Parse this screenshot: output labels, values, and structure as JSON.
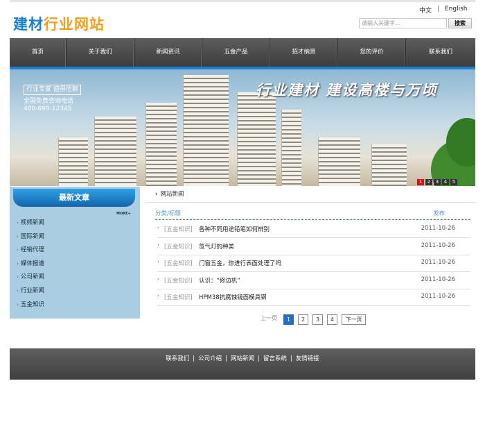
{
  "header": {
    "logo_part1": "建材",
    "logo_part2": "行业网站",
    "lang_cn": "中文",
    "lang_sep": "|",
    "lang_en": "English",
    "search_placeholder": "请输入关键字...",
    "search_button": "搜索"
  },
  "nav": [
    {
      "label": "首页"
    },
    {
      "label": "关于我们"
    },
    {
      "label": "新闻资讯"
    },
    {
      "label": "五金产品"
    },
    {
      "label": "招才纳贤"
    },
    {
      "label": "您的评价"
    },
    {
      "label": "联系我们"
    }
  ],
  "banner": {
    "tag": "行业专家 值得信赖",
    "hotline_label": "全国免费咨询电话",
    "hotline": "400-699-12345",
    "slogan": "行业建材  建设高楼与万顷",
    "pages": [
      "1",
      "2",
      "3",
      "4",
      "5"
    ]
  },
  "sidebar": {
    "title": "最新文章",
    "more": "MORE+",
    "items": [
      "视频新闻",
      "国际新闻",
      "经销代理",
      "媒体报道",
      "公司新闻",
      "行业新闻",
      "五金知识"
    ]
  },
  "content": {
    "tab_arrow": "›",
    "tab": "网站新闻",
    "col_title": "分类/标题",
    "col_date": "发布",
    "rows": [
      {
        "cat": "[五金知识]",
        "title": "各种不同用途铅笔如何辨别",
        "date": "2011-10-26"
      },
      {
        "cat": "[五金知识]",
        "title": "氙气灯的种类",
        "date": "2011-10-26"
      },
      {
        "cat": "[五金知识]",
        "title": "门窗五金，你进行表面处理了吗",
        "date": "2011-10-26"
      },
      {
        "cat": "[五金知识]",
        "title": "认识：“修边机”",
        "date": "2011-10-26"
      },
      {
        "cat": "[五金知识]",
        "title": "HPM38抗腐蚀镜面模具钢",
        "date": "2011-10-26"
      }
    ],
    "pagination": {
      "prev": "上一页",
      "pages": [
        "1",
        "2",
        "3",
        "4"
      ],
      "next": "下一页"
    }
  },
  "footer": {
    "links": [
      "联系我们",
      "公司介绍",
      "网站新闻",
      "留言系统",
      "友情链接"
    ],
    "sep": "|"
  }
}
